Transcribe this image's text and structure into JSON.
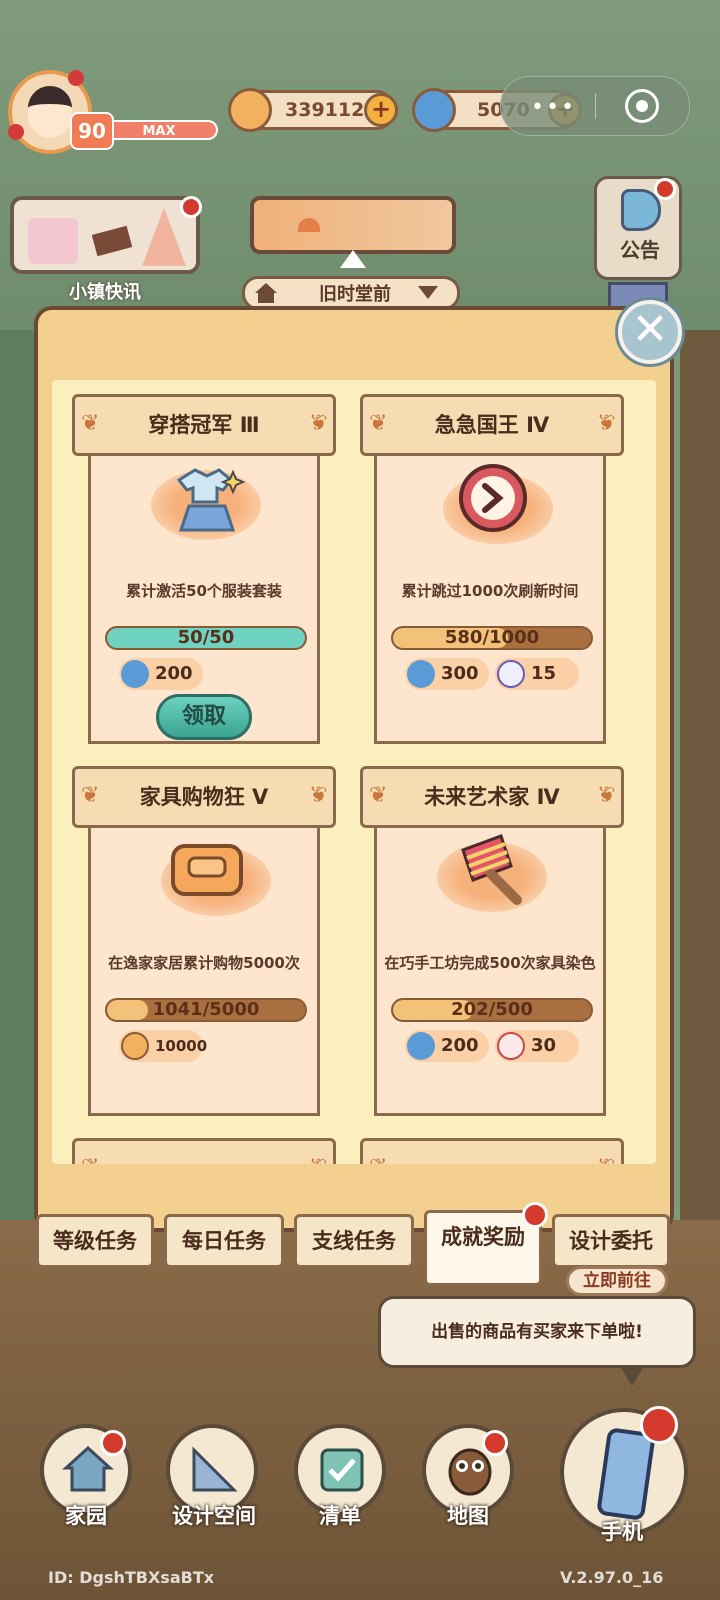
{
  "player": {
    "level": "90",
    "exp_label": "MAX"
  },
  "currencies": [
    {
      "icon": "coin-icon",
      "value": "339112"
    },
    {
      "icon": "swirl-gem-icon",
      "value": "5070"
    }
  ],
  "news": {
    "label": "小镇快讯"
  },
  "room": {
    "name": "旧时堂前"
  },
  "notice": {
    "label": "公告"
  },
  "modal": {
    "cards": [
      {
        "title": "穿搭冠军 Ⅲ",
        "icon": "outfit-icon",
        "desc": "累计激活50个服装套装",
        "progress": "50/50",
        "progress_value": 1.0,
        "rewards": [
          {
            "icon": "swirl-gem-icon",
            "value": "200"
          }
        ],
        "claim_label": "领取"
      },
      {
        "title": "急急国王 Ⅳ",
        "icon": "clock-icon",
        "desc": "累计跳过1000次刷新时间",
        "progress": "580/1000",
        "progress_value": 0.58,
        "rewards": [
          {
            "icon": "swirl-gem-icon",
            "value": "300"
          },
          {
            "icon": "voucher-icon",
            "value": "15"
          }
        ]
      },
      {
        "title": "家具购物狂 Ⅴ",
        "icon": "sofa-icon",
        "desc": "在逸家家居累计购物5000次",
        "progress": "1041/5000",
        "progress_value": 0.2082,
        "rewards": [
          {
            "icon": "coin-icon",
            "value": "10000"
          }
        ]
      },
      {
        "title": "未来艺术家 Ⅳ",
        "icon": "paint-brush-icon",
        "desc": "在巧手工坊完成500次家具染色",
        "progress": "202/500",
        "progress_value": 0.404,
        "rewards": [
          {
            "icon": "swirl-gem-icon",
            "value": "200"
          },
          {
            "icon": "ticket-icon",
            "value": "30"
          }
        ]
      }
    ]
  },
  "tabs": [
    {
      "label": "等级任务",
      "active": false
    },
    {
      "label": "每日任务",
      "active": false
    },
    {
      "label": "支线任务",
      "active": false
    },
    {
      "label": "成就奖励",
      "active": true
    },
    {
      "label": "设计委托",
      "active": false
    }
  ],
  "toast": {
    "go_label": "立即前往",
    "message": "出售的商品有买家来下单啦!"
  },
  "nav": [
    {
      "label": "家园",
      "icon": "home-icon"
    },
    {
      "label": "设计空间",
      "icon": "ruler-icon"
    },
    {
      "label": "清单",
      "icon": "checklist-icon"
    },
    {
      "label": "地图",
      "icon": "owl-map-icon"
    },
    {
      "label": "手机",
      "icon": "phone-icon"
    }
  ],
  "footer": {
    "id": "ID: DgshTBXsaBTx",
    "version": "V.2.97.0_16"
  },
  "colors": {
    "progress_complete": "#6fd3c2",
    "progress_partial": "#f3c27a",
    "accent_red": "#d33a2c"
  }
}
